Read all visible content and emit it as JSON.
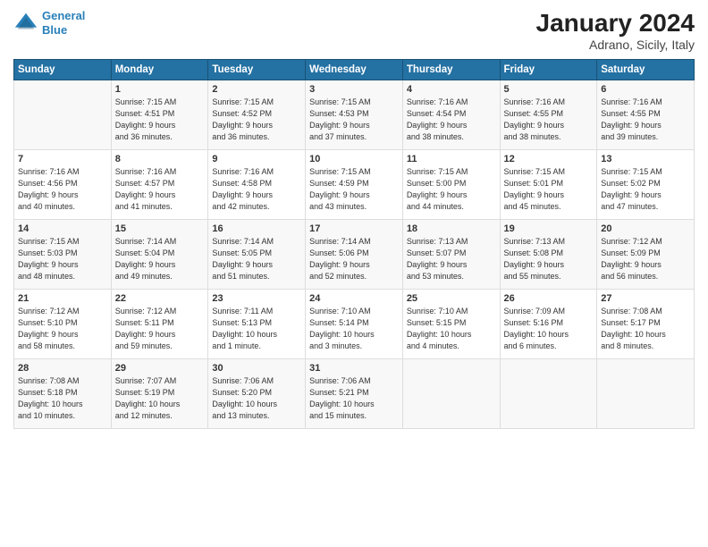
{
  "header": {
    "logo_line1": "General",
    "logo_line2": "Blue",
    "month": "January 2024",
    "location": "Adrano, Sicily, Italy"
  },
  "days_of_week": [
    "Sunday",
    "Monday",
    "Tuesday",
    "Wednesday",
    "Thursday",
    "Friday",
    "Saturday"
  ],
  "weeks": [
    [
      {
        "num": "",
        "info": ""
      },
      {
        "num": "1",
        "info": "Sunrise: 7:15 AM\nSunset: 4:51 PM\nDaylight: 9 hours\nand 36 minutes."
      },
      {
        "num": "2",
        "info": "Sunrise: 7:15 AM\nSunset: 4:52 PM\nDaylight: 9 hours\nand 36 minutes."
      },
      {
        "num": "3",
        "info": "Sunrise: 7:15 AM\nSunset: 4:53 PM\nDaylight: 9 hours\nand 37 minutes."
      },
      {
        "num": "4",
        "info": "Sunrise: 7:16 AM\nSunset: 4:54 PM\nDaylight: 9 hours\nand 38 minutes."
      },
      {
        "num": "5",
        "info": "Sunrise: 7:16 AM\nSunset: 4:55 PM\nDaylight: 9 hours\nand 38 minutes."
      },
      {
        "num": "6",
        "info": "Sunrise: 7:16 AM\nSunset: 4:55 PM\nDaylight: 9 hours\nand 39 minutes."
      }
    ],
    [
      {
        "num": "7",
        "info": "Sunrise: 7:16 AM\nSunset: 4:56 PM\nDaylight: 9 hours\nand 40 minutes."
      },
      {
        "num": "8",
        "info": "Sunrise: 7:16 AM\nSunset: 4:57 PM\nDaylight: 9 hours\nand 41 minutes."
      },
      {
        "num": "9",
        "info": "Sunrise: 7:16 AM\nSunset: 4:58 PM\nDaylight: 9 hours\nand 42 minutes."
      },
      {
        "num": "10",
        "info": "Sunrise: 7:15 AM\nSunset: 4:59 PM\nDaylight: 9 hours\nand 43 minutes."
      },
      {
        "num": "11",
        "info": "Sunrise: 7:15 AM\nSunset: 5:00 PM\nDaylight: 9 hours\nand 44 minutes."
      },
      {
        "num": "12",
        "info": "Sunrise: 7:15 AM\nSunset: 5:01 PM\nDaylight: 9 hours\nand 45 minutes."
      },
      {
        "num": "13",
        "info": "Sunrise: 7:15 AM\nSunset: 5:02 PM\nDaylight: 9 hours\nand 47 minutes."
      }
    ],
    [
      {
        "num": "14",
        "info": "Sunrise: 7:15 AM\nSunset: 5:03 PM\nDaylight: 9 hours\nand 48 minutes."
      },
      {
        "num": "15",
        "info": "Sunrise: 7:14 AM\nSunset: 5:04 PM\nDaylight: 9 hours\nand 49 minutes."
      },
      {
        "num": "16",
        "info": "Sunrise: 7:14 AM\nSunset: 5:05 PM\nDaylight: 9 hours\nand 51 minutes."
      },
      {
        "num": "17",
        "info": "Sunrise: 7:14 AM\nSunset: 5:06 PM\nDaylight: 9 hours\nand 52 minutes."
      },
      {
        "num": "18",
        "info": "Sunrise: 7:13 AM\nSunset: 5:07 PM\nDaylight: 9 hours\nand 53 minutes."
      },
      {
        "num": "19",
        "info": "Sunrise: 7:13 AM\nSunset: 5:08 PM\nDaylight: 9 hours\nand 55 minutes."
      },
      {
        "num": "20",
        "info": "Sunrise: 7:12 AM\nSunset: 5:09 PM\nDaylight: 9 hours\nand 56 minutes."
      }
    ],
    [
      {
        "num": "21",
        "info": "Sunrise: 7:12 AM\nSunset: 5:10 PM\nDaylight: 9 hours\nand 58 minutes."
      },
      {
        "num": "22",
        "info": "Sunrise: 7:12 AM\nSunset: 5:11 PM\nDaylight: 9 hours\nand 59 minutes."
      },
      {
        "num": "23",
        "info": "Sunrise: 7:11 AM\nSunset: 5:13 PM\nDaylight: 10 hours\nand 1 minute."
      },
      {
        "num": "24",
        "info": "Sunrise: 7:10 AM\nSunset: 5:14 PM\nDaylight: 10 hours\nand 3 minutes."
      },
      {
        "num": "25",
        "info": "Sunrise: 7:10 AM\nSunset: 5:15 PM\nDaylight: 10 hours\nand 4 minutes."
      },
      {
        "num": "26",
        "info": "Sunrise: 7:09 AM\nSunset: 5:16 PM\nDaylight: 10 hours\nand 6 minutes."
      },
      {
        "num": "27",
        "info": "Sunrise: 7:08 AM\nSunset: 5:17 PM\nDaylight: 10 hours\nand 8 minutes."
      }
    ],
    [
      {
        "num": "28",
        "info": "Sunrise: 7:08 AM\nSunset: 5:18 PM\nDaylight: 10 hours\nand 10 minutes."
      },
      {
        "num": "29",
        "info": "Sunrise: 7:07 AM\nSunset: 5:19 PM\nDaylight: 10 hours\nand 12 minutes."
      },
      {
        "num": "30",
        "info": "Sunrise: 7:06 AM\nSunset: 5:20 PM\nDaylight: 10 hours\nand 13 minutes."
      },
      {
        "num": "31",
        "info": "Sunrise: 7:06 AM\nSunset: 5:21 PM\nDaylight: 10 hours\nand 15 minutes."
      },
      {
        "num": "",
        "info": ""
      },
      {
        "num": "",
        "info": ""
      },
      {
        "num": "",
        "info": ""
      }
    ]
  ]
}
